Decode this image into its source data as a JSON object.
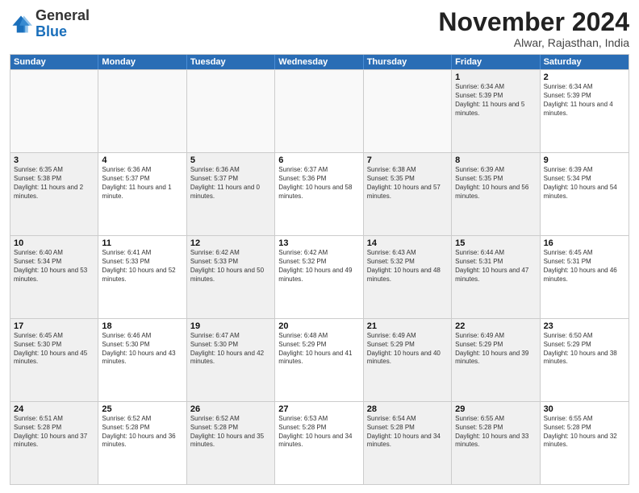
{
  "logo": {
    "general": "General",
    "blue": "Blue"
  },
  "header": {
    "month": "November 2024",
    "location": "Alwar, Rajasthan, India"
  },
  "weekdays": [
    "Sunday",
    "Monday",
    "Tuesday",
    "Wednesday",
    "Thursday",
    "Friday",
    "Saturday"
  ],
  "rows": [
    [
      {
        "day": "",
        "info": "",
        "empty": true
      },
      {
        "day": "",
        "info": "",
        "empty": true
      },
      {
        "day": "",
        "info": "",
        "empty": true
      },
      {
        "day": "",
        "info": "",
        "empty": true
      },
      {
        "day": "",
        "info": "",
        "empty": true
      },
      {
        "day": "1",
        "info": "Sunrise: 6:34 AM\nSunset: 5:39 PM\nDaylight: 11 hours and 5 minutes.",
        "shaded": true
      },
      {
        "day": "2",
        "info": "Sunrise: 6:34 AM\nSunset: 5:39 PM\nDaylight: 11 hours and 4 minutes."
      }
    ],
    [
      {
        "day": "3",
        "info": "Sunrise: 6:35 AM\nSunset: 5:38 PM\nDaylight: 11 hours and 2 minutes.",
        "shaded": true
      },
      {
        "day": "4",
        "info": "Sunrise: 6:36 AM\nSunset: 5:37 PM\nDaylight: 11 hours and 1 minute."
      },
      {
        "day": "5",
        "info": "Sunrise: 6:36 AM\nSunset: 5:37 PM\nDaylight: 11 hours and 0 minutes.",
        "shaded": true
      },
      {
        "day": "6",
        "info": "Sunrise: 6:37 AM\nSunset: 5:36 PM\nDaylight: 10 hours and 58 minutes."
      },
      {
        "day": "7",
        "info": "Sunrise: 6:38 AM\nSunset: 5:35 PM\nDaylight: 10 hours and 57 minutes.",
        "shaded": true
      },
      {
        "day": "8",
        "info": "Sunrise: 6:39 AM\nSunset: 5:35 PM\nDaylight: 10 hours and 56 minutes.",
        "shaded": true
      },
      {
        "day": "9",
        "info": "Sunrise: 6:39 AM\nSunset: 5:34 PM\nDaylight: 10 hours and 54 minutes."
      }
    ],
    [
      {
        "day": "10",
        "info": "Sunrise: 6:40 AM\nSunset: 5:34 PM\nDaylight: 10 hours and 53 minutes.",
        "shaded": true
      },
      {
        "day": "11",
        "info": "Sunrise: 6:41 AM\nSunset: 5:33 PM\nDaylight: 10 hours and 52 minutes."
      },
      {
        "day": "12",
        "info": "Sunrise: 6:42 AM\nSunset: 5:33 PM\nDaylight: 10 hours and 50 minutes.",
        "shaded": true
      },
      {
        "day": "13",
        "info": "Sunrise: 6:42 AM\nSunset: 5:32 PM\nDaylight: 10 hours and 49 minutes."
      },
      {
        "day": "14",
        "info": "Sunrise: 6:43 AM\nSunset: 5:32 PM\nDaylight: 10 hours and 48 minutes.",
        "shaded": true
      },
      {
        "day": "15",
        "info": "Sunrise: 6:44 AM\nSunset: 5:31 PM\nDaylight: 10 hours and 47 minutes.",
        "shaded": true
      },
      {
        "day": "16",
        "info": "Sunrise: 6:45 AM\nSunset: 5:31 PM\nDaylight: 10 hours and 46 minutes."
      }
    ],
    [
      {
        "day": "17",
        "info": "Sunrise: 6:45 AM\nSunset: 5:30 PM\nDaylight: 10 hours and 45 minutes.",
        "shaded": true
      },
      {
        "day": "18",
        "info": "Sunrise: 6:46 AM\nSunset: 5:30 PM\nDaylight: 10 hours and 43 minutes."
      },
      {
        "day": "19",
        "info": "Sunrise: 6:47 AM\nSunset: 5:30 PM\nDaylight: 10 hours and 42 minutes.",
        "shaded": true
      },
      {
        "day": "20",
        "info": "Sunrise: 6:48 AM\nSunset: 5:29 PM\nDaylight: 10 hours and 41 minutes."
      },
      {
        "day": "21",
        "info": "Sunrise: 6:49 AM\nSunset: 5:29 PM\nDaylight: 10 hours and 40 minutes.",
        "shaded": true
      },
      {
        "day": "22",
        "info": "Sunrise: 6:49 AM\nSunset: 5:29 PM\nDaylight: 10 hours and 39 minutes.",
        "shaded": true
      },
      {
        "day": "23",
        "info": "Sunrise: 6:50 AM\nSunset: 5:29 PM\nDaylight: 10 hours and 38 minutes."
      }
    ],
    [
      {
        "day": "24",
        "info": "Sunrise: 6:51 AM\nSunset: 5:28 PM\nDaylight: 10 hours and 37 minutes.",
        "shaded": true
      },
      {
        "day": "25",
        "info": "Sunrise: 6:52 AM\nSunset: 5:28 PM\nDaylight: 10 hours and 36 minutes."
      },
      {
        "day": "26",
        "info": "Sunrise: 6:52 AM\nSunset: 5:28 PM\nDaylight: 10 hours and 35 minutes.",
        "shaded": true
      },
      {
        "day": "27",
        "info": "Sunrise: 6:53 AM\nSunset: 5:28 PM\nDaylight: 10 hours and 34 minutes."
      },
      {
        "day": "28",
        "info": "Sunrise: 6:54 AM\nSunset: 5:28 PM\nDaylight: 10 hours and 34 minutes.",
        "shaded": true
      },
      {
        "day": "29",
        "info": "Sunrise: 6:55 AM\nSunset: 5:28 PM\nDaylight: 10 hours and 33 minutes.",
        "shaded": true
      },
      {
        "day": "30",
        "info": "Sunrise: 6:55 AM\nSunset: 5:28 PM\nDaylight: 10 hours and 32 minutes."
      }
    ]
  ]
}
